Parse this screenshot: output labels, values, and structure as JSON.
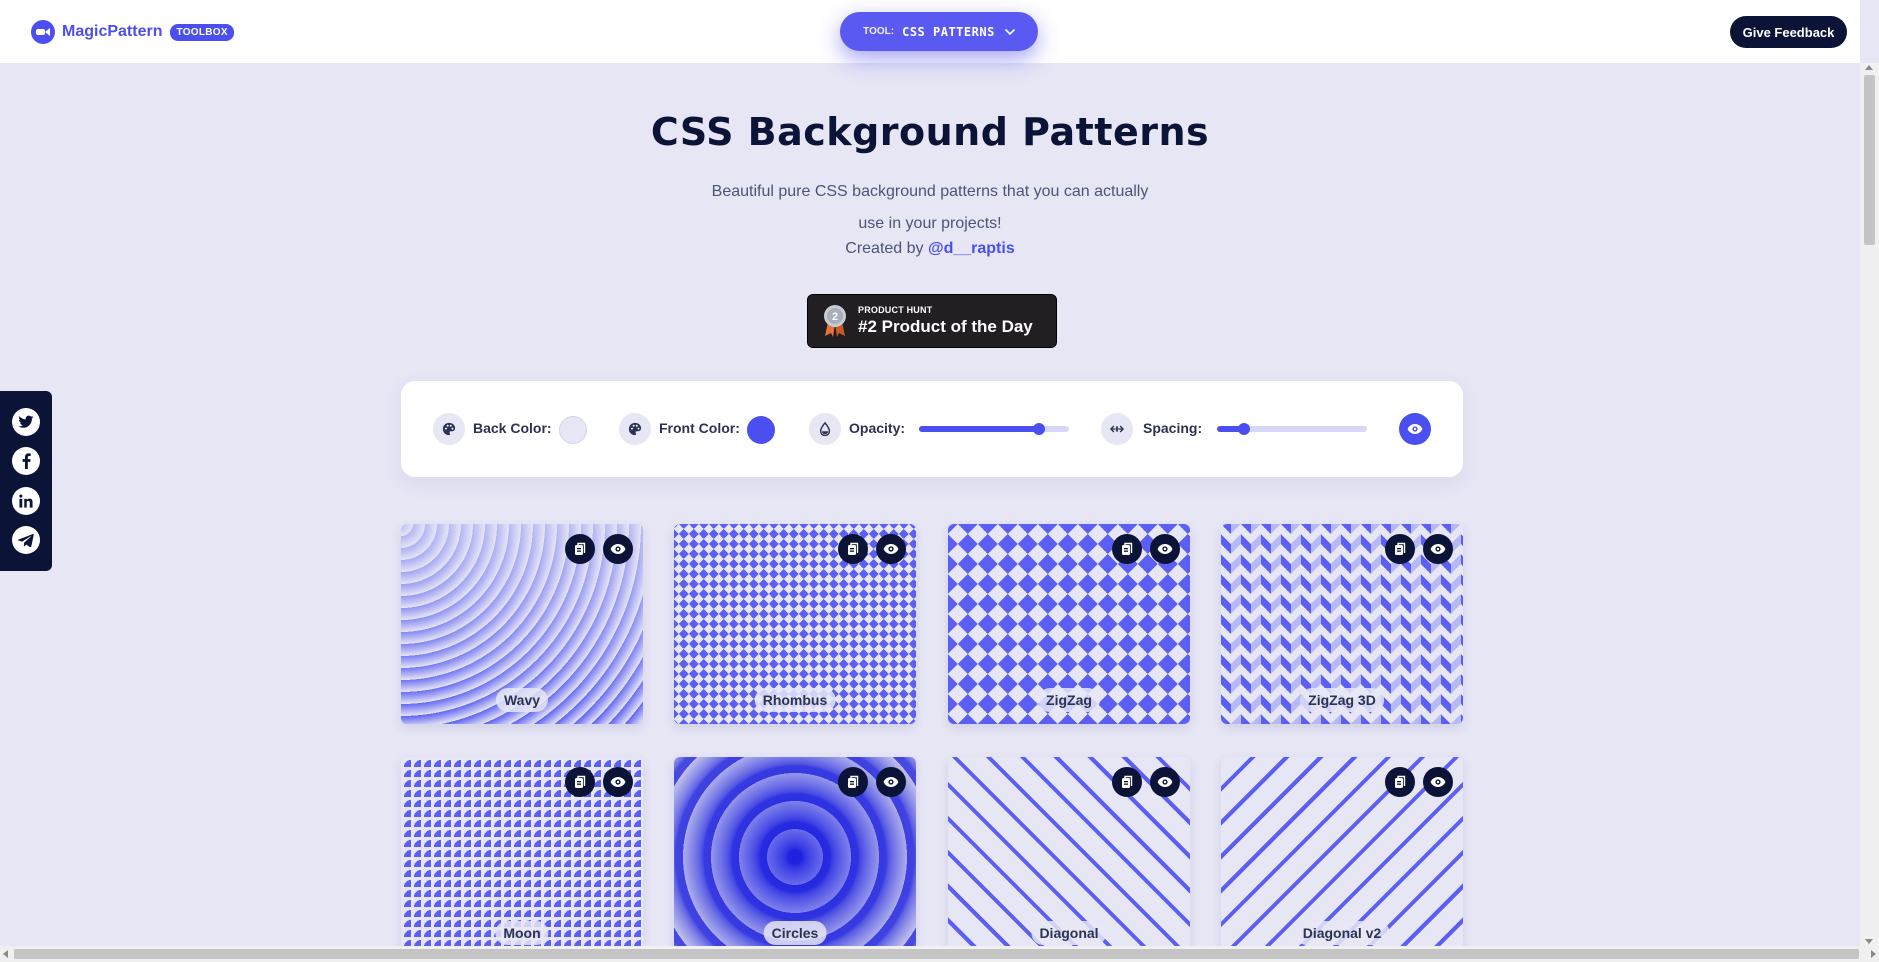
{
  "header": {
    "brand": "MagicPattern",
    "badge": "TOOLBOX",
    "tool_prefix": "TOOL:",
    "tool_value": "CSS PATTERNS",
    "feedback_label": "Give Feedback"
  },
  "hero": {
    "title": "CSS Background Patterns",
    "subtitle_line1": "Beautiful pure CSS background patterns that you can actually",
    "subtitle_line2": "use in your projects!",
    "credit_prefix": "Created by ",
    "credit_handle": "@d__raptis"
  },
  "product_hunt": {
    "rank": "2",
    "small": "PRODUCT HUNT",
    "big": "#2 Product of the Day"
  },
  "controls": {
    "back_color_label": "Back Color:",
    "back_color": "#e6e6f5",
    "front_color_label": "Front Color:",
    "front_color": "#4b4ff0",
    "opacity_label": "Opacity:",
    "opacity_value": 0.8,
    "spacing_label": "Spacing:",
    "spacing_value": 0.18
  },
  "colors": {
    "accent": "#4b4ff0",
    "navy": "#0b1437",
    "page_bg": "#e6e6f5"
  },
  "patterns": [
    {
      "name": "Wavy",
      "style": "wavy"
    },
    {
      "name": "Rhombus",
      "style": "rhombus"
    },
    {
      "name": "ZigZag",
      "style": "zigzag"
    },
    {
      "name": "ZigZag 3D",
      "style": "zigzag3d"
    },
    {
      "name": "Moon",
      "style": "moon"
    },
    {
      "name": "Circles",
      "style": "circles"
    },
    {
      "name": "Diagonal",
      "style": "diagonal"
    },
    {
      "name": "Diagonal v2",
      "style": "diagonal2"
    }
  ],
  "social": [
    "twitter-icon",
    "facebook-icon",
    "linkedin-icon",
    "telegram-icon"
  ]
}
